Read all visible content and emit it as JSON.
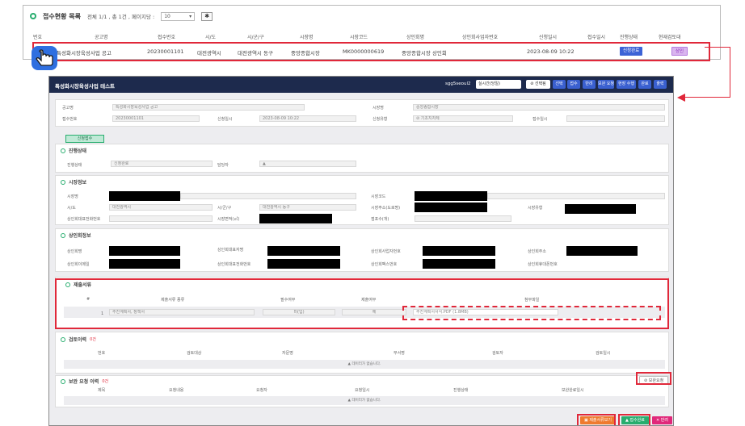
{
  "list": {
    "title": "접수현황 목록",
    "info": "전체 1/1 , 총 1건 , 페이지당 :",
    "per_page": "10",
    "icon_name": "pin-icon",
    "columns": [
      "번호",
      "공고명",
      "접수번호",
      "시/도",
      "시/군/구",
      "시장명",
      "시장코드",
      "상인회명",
      "상인회사업자번호",
      "신청일시",
      "접수일시",
      "진행상태",
      "현재검토대"
    ],
    "row": {
      "no": "1",
      "notice": "특성화시장육성사업 공고",
      "receipt_no": "20230001101",
      "sido": "대전광역시",
      "sigungu": "대전광역시 동구",
      "market": "중앙종합시장",
      "market_code": "MK0000000619",
      "merchant": "중앙종합시장 상인회",
      "biz_no": "",
      "applied_at": "2023-08-09 10:22",
      "received_at": "",
      "status": "신청완료",
      "reviewer": "상인"
    }
  },
  "detail": {
    "title": "특성화시장육성사업 테스트",
    "user": "sgg5seoul2",
    "select": "실시간(당일)",
    "btn_white": "⊘ 선택됨",
    "buttons": [
      "선택",
      "접수",
      "반려",
      "보완 요청",
      "현장 수행",
      "완료",
      "출력"
    ],
    "top": {
      "label_notice": "공고명",
      "notice": "특성화시장육성사업 공고",
      "label_market": "시장명",
      "market": "중앙종합시장",
      "label_receipt": "접수번호",
      "receipt": "20230001101",
      "label_applied": "신청일시",
      "applied": "2023-08-09 10:22",
      "label_type": "신청유형",
      "type": "⊘ 기초지자체",
      "label_rcv": "접수일시",
      "rcv": ""
    },
    "tab": "신청접수",
    "progress": {
      "title": "진행상태",
      "label_status": "진행상태",
      "status": "신청완료",
      "label_person": "담당자",
      "person": "▲"
    },
    "market": {
      "title": "시장정보",
      "label_name": "시장명",
      "label_code": "시장코드",
      "label_sido": "시/도",
      "sido": "대전광역시",
      "label_sgg": "시/군/구",
      "sgg": "대전광역시 동구",
      "label_addr": "시장주소(도로명)",
      "label_type": "시장유형",
      "label_phone": "상인회대표전화번호",
      "label_area": "시장면적(㎡)",
      "label_cnt": "점포수(개)"
    },
    "merchant": {
      "title": "상인회정보",
      "label_name": "상인회명",
      "label_rep": "상인회대표자명",
      "label_biz": "상인회사업자번호",
      "label_addr": "상인회주소",
      "label_email": "상인회이메일",
      "label_phone": "상인회대표전화번호",
      "label_fax": "상인회팩스번호",
      "label_mobile": "상인회휴대폰번호"
    },
    "docs": {
      "title": "제출서류",
      "col_no": "#",
      "col_name": "제출서류 종류",
      "col_req": "필수여부",
      "col_submit": "제출여부",
      "col_file": "첨부파일",
      "row_no": "1",
      "row_name": "추진계획서, 정책서",
      "row_req": "미(입)",
      "row_submit": "예",
      "file": "추진계획서서식.PDF (1.8MB)"
    },
    "review": {
      "title": "검토이력",
      "count": "0건",
      "cols": [
        "번호",
        "검토대상",
        "자문명",
        "부서명",
        "검토자",
        "검토일시"
      ],
      "empty": "데이터가 없습니다."
    },
    "supplement": {
      "title": "보완 요청 이력",
      "count": "0건",
      "button": "⊘ 보완요청",
      "cols": [
        "제목",
        "요청내용",
        "요청자",
        "요청일시",
        "진행상태",
        "보완완료일시"
      ],
      "empty": "데이터가 없습니다."
    },
    "footer": {
      "preview": "▣ 제출서류보기",
      "submit": "▲ 접수완료",
      "reject": "✕ 반려"
    }
  },
  "colors": {
    "accent": "#e0283a",
    "brand": "#1d2a4d",
    "green": "#27ad6e",
    "blue": "#3c63d6"
  }
}
